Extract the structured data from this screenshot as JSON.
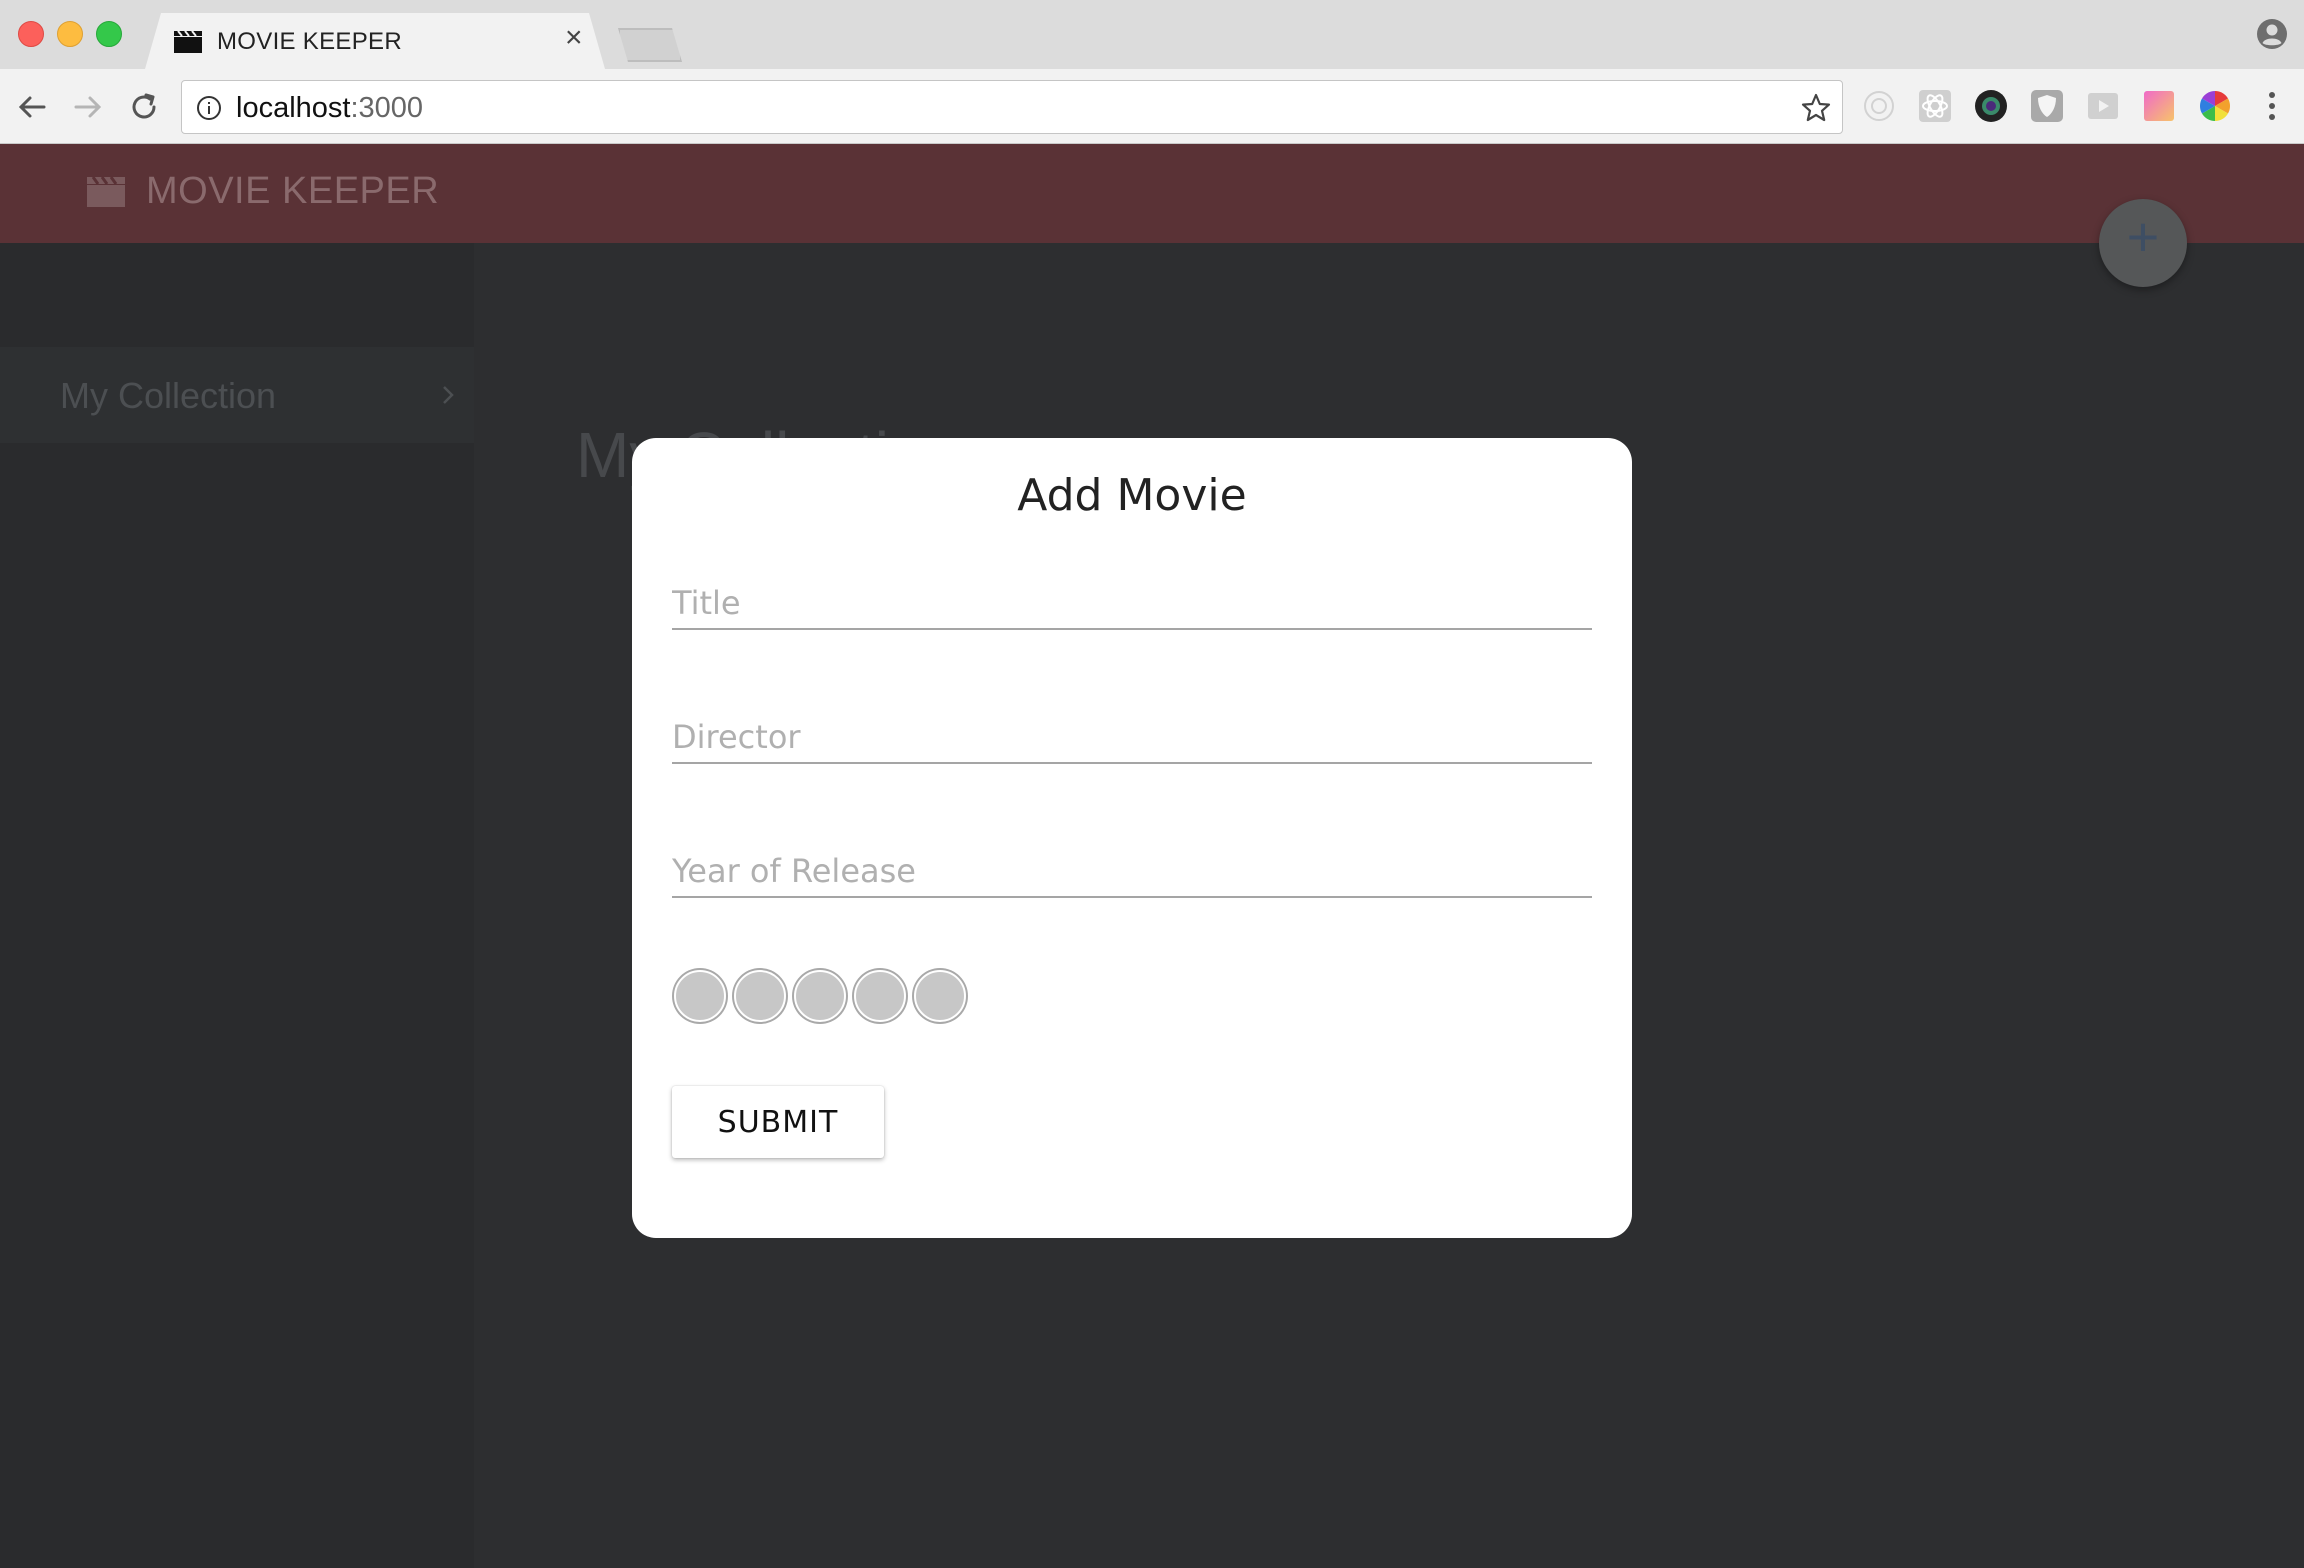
{
  "browser": {
    "tab_title": "MOVIE KEEPER",
    "url_host": "localhost",
    "url_port": ":3000"
  },
  "app": {
    "brand": "MOVIE KEEPER",
    "fab_label": "+",
    "sidebar": {
      "items": [
        {
          "label": "My Collection"
        }
      ]
    },
    "page_title": "My Collection"
  },
  "modal": {
    "title": "Add Movie",
    "fields": {
      "title_placeholder": "Title",
      "director_placeholder": "Director",
      "year_placeholder": "Year of Release"
    },
    "rating": {
      "max": 5,
      "value": 0
    },
    "submit_label": "SUBMIT"
  },
  "colors": {
    "header": "#5a3236",
    "overlay_bg": "#2d2e30",
    "modal_bg": "#ffffff"
  },
  "icons": {
    "tab_favicon": "clapperboard-icon",
    "logo": "clapperboard-icon",
    "fab": "plus-icon",
    "sidebar_chevron": "chevron-right-icon"
  }
}
